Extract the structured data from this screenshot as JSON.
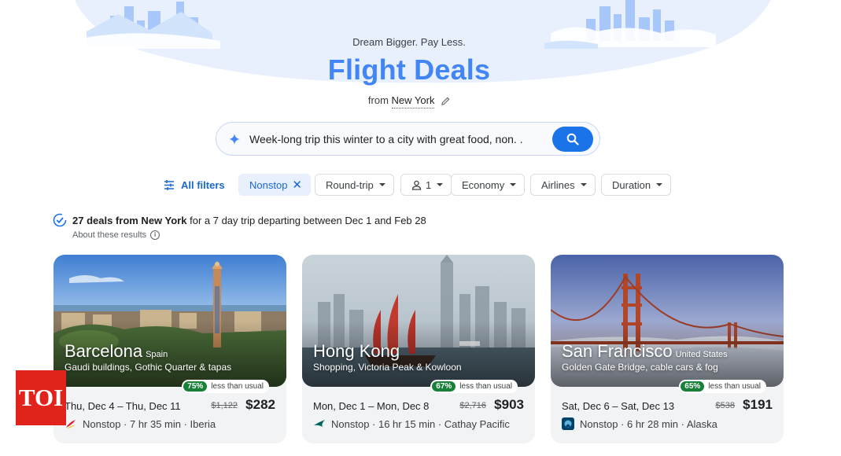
{
  "hero": {
    "tagline": "Dream Bigger. Pay Less.",
    "title": "Flight Deals",
    "from_label": "from",
    "from_city": "New York"
  },
  "search": {
    "query": "Week-long trip this winter to a city with great food, non. ."
  },
  "filters": {
    "all_filters": "All filters",
    "nonstop": "Nonstop",
    "round_trip": "Round-trip",
    "passengers": "1",
    "cabin": "Economy",
    "airlines": "Airlines",
    "duration": "Duration"
  },
  "summary": {
    "count_text": "27 deals from New York",
    "rest_text": " for a 7 day trip departing between Dec 1 and Feb 28",
    "about": "About these results"
  },
  "cards": [
    {
      "city": "Barcelona",
      "country": "Spain",
      "description": "Gaudi buildings, Gothic Quarter & tapas",
      "discount": "75%",
      "discount_label": "less than usual",
      "dates": "Thu, Dec 4 – Thu, Dec 11",
      "old_price": "$1,122",
      "price": "$282",
      "flight": "Nonstop · 7 hr 35 min · Iberia"
    },
    {
      "city": "Hong Kong",
      "country": "",
      "description": "Shopping, Victoria Peak & Kowloon",
      "discount": "67%",
      "discount_label": "less than usual",
      "dates": "Mon, Dec 1 – Mon, Dec 8",
      "old_price": "$2,716",
      "price": "$903",
      "flight": "Nonstop · 16 hr 15 min · Cathay Pacific"
    },
    {
      "city": "San Francisco",
      "country": "United States",
      "description": "Golden Gate Bridge, cable cars & fog",
      "discount": "65%",
      "discount_label": "less than usual",
      "dates": "Sat, Dec 6 – Sat, Dec 13",
      "old_price": "$538",
      "price": "$191",
      "flight": "Nonstop · 6 hr 28 min · Alaska"
    }
  ],
  "watermark": "TOI",
  "colors": {
    "brand_blue": "#4285f4",
    "action_blue": "#1a73e8",
    "discount_green": "#188038",
    "toi_red": "#e0231b"
  }
}
